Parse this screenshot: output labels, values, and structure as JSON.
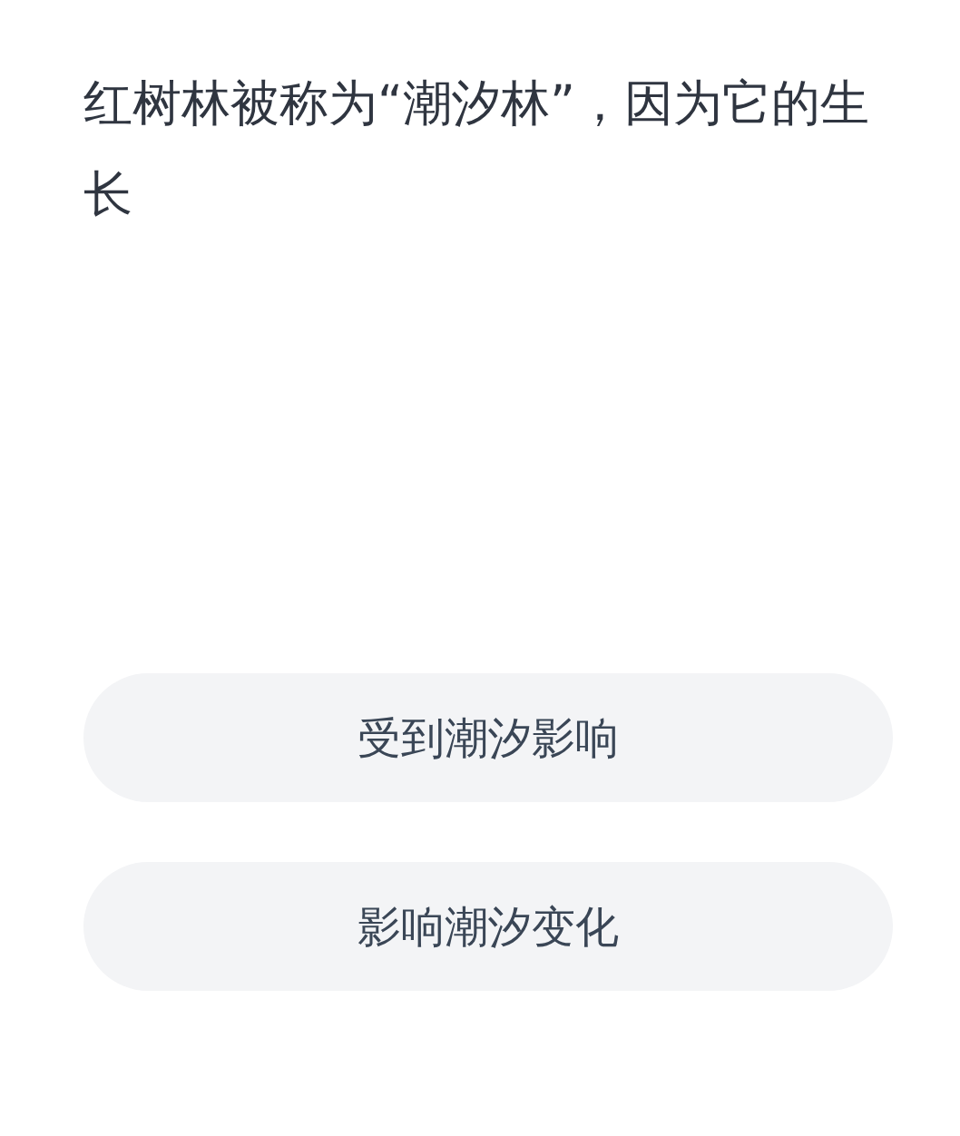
{
  "question": "红树林被称为“潮汐林”，因为它的生长",
  "options": [
    {
      "label": "受到潮汐影响"
    },
    {
      "label": "影响潮汐变化"
    }
  ]
}
